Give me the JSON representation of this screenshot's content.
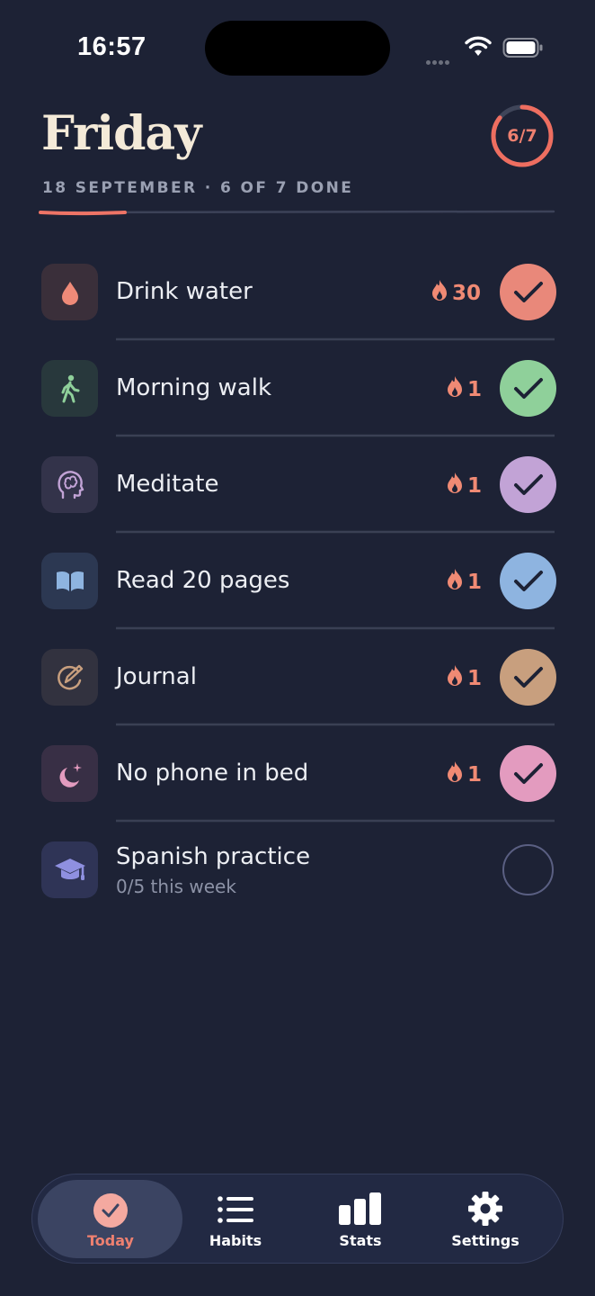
{
  "status_bar": {
    "time": "16:57"
  },
  "header": {
    "title": "Friday",
    "subtitle": "18 SEPTEMBER · 6 OF 7 DONE",
    "progress_label": "6/7",
    "progress_fraction": 0.857
  },
  "habits": [
    {
      "name": "Drink water",
      "icon": "water-drop-icon",
      "streak": "30",
      "done": true,
      "color": "#e9887a"
    },
    {
      "name": "Morning walk",
      "icon": "walking-icon",
      "streak": "1",
      "done": true,
      "color": "#8fd09a"
    },
    {
      "name": "Meditate",
      "icon": "brain-head-icon",
      "streak": "1",
      "done": true,
      "color": "#c2a3d6"
    },
    {
      "name": "Read 20 pages",
      "icon": "open-book-icon",
      "streak": "1",
      "done": true,
      "color": "#8eb4e0"
    },
    {
      "name": "Journal",
      "icon": "pencil-circle-icon",
      "streak": "1",
      "done": true,
      "color": "#c89f7e"
    },
    {
      "name": "No phone in bed",
      "icon": "moon-stars-icon",
      "streak": "1",
      "done": true,
      "color": "#e39bbf"
    },
    {
      "name": "Spanish practice",
      "sub": "0/5 this week",
      "icon": "graduation-cap-icon",
      "done": false,
      "color": "#5a5f82"
    }
  ],
  "tabs": [
    {
      "label": "Today",
      "icon": "check-circle-icon",
      "active": true
    },
    {
      "label": "Habits",
      "icon": "list-icon",
      "active": false
    },
    {
      "label": "Stats",
      "icon": "bar-chart-icon",
      "active": false
    },
    {
      "label": "Settings",
      "icon": "gear-icon",
      "active": false
    }
  ],
  "colors": {
    "background": "#1d2235",
    "accent": "#ee8070",
    "title": "#f4ead8"
  }
}
